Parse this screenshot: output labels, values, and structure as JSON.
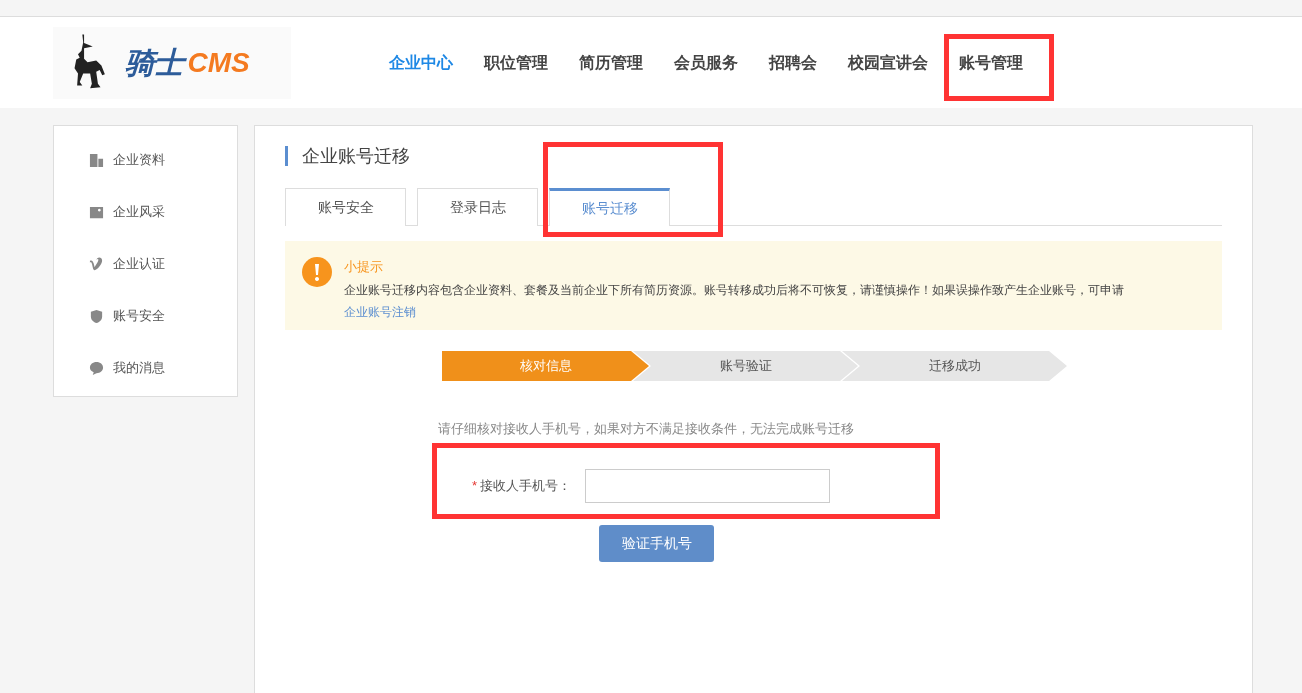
{
  "logo": {
    "text_main": "骑士",
    "text_accent": "CMS"
  },
  "nav": [
    {
      "label": "企业中心",
      "selected": true
    },
    {
      "label": "职位管理",
      "selected": false
    },
    {
      "label": "简历管理",
      "selected": false
    },
    {
      "label": "会员服务",
      "selected": false
    },
    {
      "label": "招聘会",
      "selected": false
    },
    {
      "label": "校园宣讲会",
      "selected": false
    },
    {
      "label": "账号管理",
      "selected": false
    }
  ],
  "sidebar": {
    "items": [
      {
        "label": "企业资料"
      },
      {
        "label": "企业风采"
      },
      {
        "label": "企业认证"
      },
      {
        "label": "账号安全"
      },
      {
        "label": "我的消息"
      }
    ]
  },
  "page_title": "企业账号迁移",
  "tabs": [
    {
      "label": "账号安全",
      "selected": false
    },
    {
      "label": "登录日志",
      "selected": false
    },
    {
      "label": "账号迁移",
      "selected": true
    }
  ],
  "notice": {
    "title": "小提示",
    "text": "企业账号迁移内容包含企业资料、套餐及当前企业下所有简历资源。账号转移成功后将不可恢复，请谨慎操作！如果误操作致产生企业账号，可申请",
    "link": "企业账号注销"
  },
  "steps": [
    {
      "label": "核对信息",
      "selected": true
    },
    {
      "label": "账号验证",
      "selected": false
    },
    {
      "label": "迁移成功",
      "selected": false
    }
  ],
  "form": {
    "hint": "请仔细核对接收人手机号，如果对方不满足接收条件，无法完成账号迁移",
    "required_mark": "*",
    "label": "接收人手机号：",
    "submit": "验证手机号"
  }
}
